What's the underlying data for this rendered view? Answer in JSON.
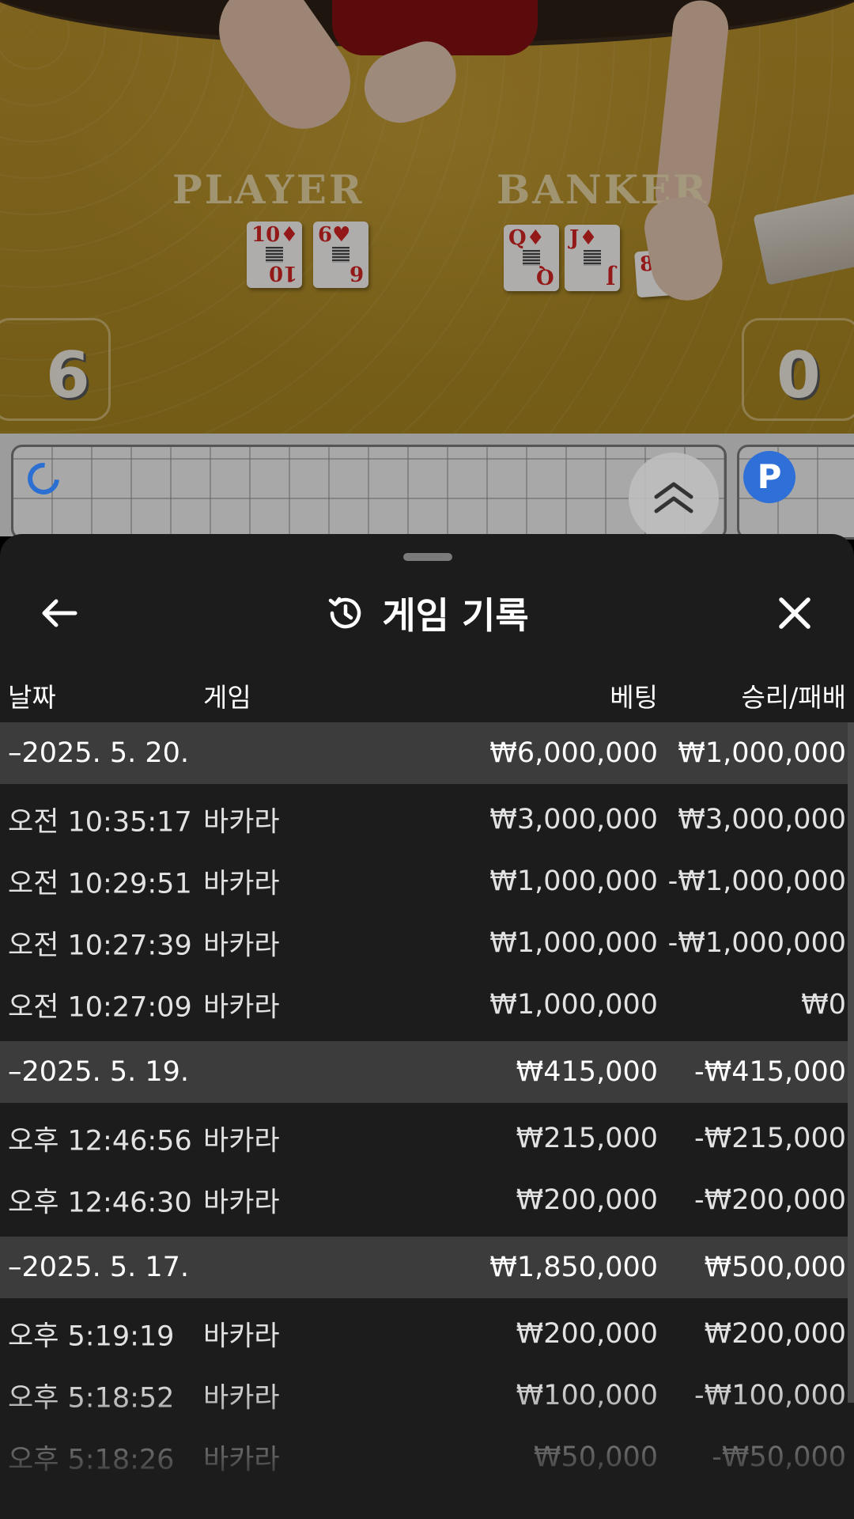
{
  "video": {
    "player_label": "PLAYER",
    "banker_label": "BANKER",
    "player_score": "6",
    "banker_score": "0",
    "player_cards": [
      {
        "rank": "10",
        "suit": "♦"
      },
      {
        "rank": "6",
        "suit": "♥"
      }
    ],
    "banker_cards": [
      {
        "rank": "Q",
        "suit": "♦"
      },
      {
        "rank": "J",
        "suit": "♦"
      },
      {
        "rank": "8",
        "suit": "♦"
      }
    ]
  },
  "roadmap": {
    "badge_label": "P"
  },
  "sheet": {
    "title": "게임 기록",
    "icons": {
      "back": "arrow-left-icon",
      "history": "history-icon",
      "close": "close-icon",
      "collapse": "chevron-double-up-icon"
    },
    "columns": {
      "date": "날짜",
      "game": "게임",
      "bet": "베팅",
      "result": "승리/패배"
    },
    "groups": [
      {
        "date": "–2025. 5. 20.",
        "bet_total": "₩6,000,000",
        "result_total": "₩1,000,000",
        "rows": [
          {
            "time": "오전 10:35:17",
            "game": "바카라",
            "bet": "₩3,000,000",
            "result": "₩3,000,000"
          },
          {
            "time": "오전 10:29:51",
            "game": "바카라",
            "bet": "₩1,000,000",
            "result": "-₩1,000,000"
          },
          {
            "time": "오전 10:27:39",
            "game": "바카라",
            "bet": "₩1,000,000",
            "result": "-₩1,000,000"
          },
          {
            "time": "오전 10:27:09",
            "game": "바카라",
            "bet": "₩1,000,000",
            "result": "₩0"
          }
        ]
      },
      {
        "date": "–2025. 5. 19.",
        "bet_total": "₩415,000",
        "result_total": "-₩415,000",
        "rows": [
          {
            "time": "오후 12:46:56",
            "game": "바카라",
            "bet": "₩215,000",
            "result": "-₩215,000"
          },
          {
            "time": "오후 12:46:30",
            "game": "바카라",
            "bet": "₩200,000",
            "result": "-₩200,000"
          }
        ]
      },
      {
        "date": "–2025. 5. 17.",
        "bet_total": "₩1,850,000",
        "result_total": "₩500,000",
        "rows": [
          {
            "time": "오후 5:19:19",
            "game": "바카라",
            "bet": "₩200,000",
            "result": "₩200,000"
          },
          {
            "time": "오후 5:18:52",
            "game": "바카라",
            "bet": "₩100,000",
            "result": "-₩100,000"
          },
          {
            "time": "오후 5:18:26",
            "game": "바카라",
            "bet": "₩50,000",
            "result": "-₩50,000"
          }
        ]
      }
    ]
  }
}
